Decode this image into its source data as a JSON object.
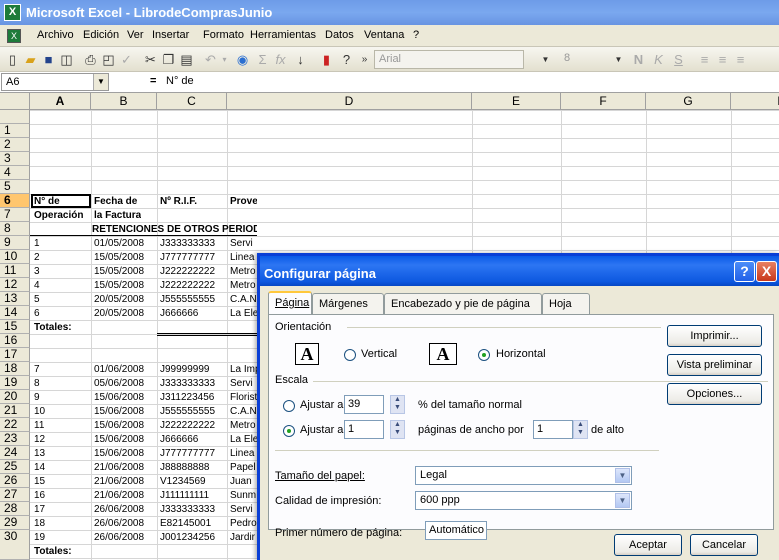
{
  "window": {
    "title": "Microsoft Excel - LibrodeComprasJunio",
    "icon": "excel-icon"
  },
  "menu": [
    "Archivo",
    "Edición",
    "Ver",
    "Insertar",
    "Formato",
    "Herramientas",
    "Datos",
    "Ventana",
    "?"
  ],
  "toolbar": {
    "font": "Arial",
    "size": "8",
    "bold": "N",
    "italic": "K",
    "underline": "S"
  },
  "formula": {
    "namebox": "A6",
    "fx": "=",
    "value": "N° de"
  },
  "columns": [
    "A",
    "B",
    "C",
    "D",
    "E",
    "F",
    "G",
    "H"
  ],
  "rows": [
    "1",
    "2",
    "3",
    "4",
    "5",
    "6",
    "7",
    "8",
    "9",
    "10",
    "11",
    "12",
    "13",
    "14",
    "15",
    "16",
    "17",
    "18",
    "19",
    "20",
    "21",
    "22",
    "23",
    "24",
    "25",
    "26",
    "27",
    "28",
    "29",
    "30"
  ],
  "sheet": {
    "header1": [
      "N° de",
      "Fecha de",
      "Nº R.I.F.",
      "Prove"
    ],
    "header2": [
      "Operación",
      "la Factura"
    ],
    "banner": "RETENCIONES DE OTROS PERIOD",
    "totales": "Totales:",
    "data": [
      [
        "1",
        "01/05/2008",
        "J333333333",
        "Servi"
      ],
      [
        "2",
        "15/05/2008",
        "J777777777",
        "Linea"
      ],
      [
        "3",
        "15/05/2008",
        "J222222222",
        "Metro"
      ],
      [
        "4",
        "15/05/2008",
        "J222222222",
        "Metro"
      ],
      [
        "5",
        "20/05/2008",
        "J555555555",
        "C.A.N"
      ],
      [
        "6",
        "20/05/2008",
        "J666666",
        "La Ele"
      ]
    ],
    "data2": [
      [
        "7",
        "01/06/2008",
        "J99999999",
        "La Imp"
      ],
      [
        "8",
        "05/06/2008",
        "J333333333",
        "Servi"
      ],
      [
        "9",
        "15/06/2008",
        "J311223456",
        "Florist"
      ],
      [
        "10",
        "15/06/2008",
        "J555555555",
        "C.A.N"
      ],
      [
        "11",
        "15/06/2008",
        "J222222222",
        "Metro"
      ],
      [
        "12",
        "15/06/2008",
        "J666666",
        "La Ele"
      ],
      [
        "13",
        "15/06/2008",
        "J777777777",
        "Linea"
      ],
      [
        "14",
        "21/06/2008",
        "J88888888",
        "Papel"
      ],
      [
        "15",
        "21/06/2008",
        "V1234569",
        "Juan"
      ],
      [
        "16",
        "21/06/2008",
        "J111111111",
        "Sunm"
      ],
      [
        "17",
        "26/06/2008",
        "J333333333",
        "Servi"
      ],
      [
        "18",
        "26/06/2008",
        "E82145001",
        "Pedro"
      ],
      [
        "19",
        "26/06/2008",
        "J001234256",
        "Jardir"
      ]
    ],
    "totales2": "Totales:"
  },
  "dialog": {
    "title": "Configurar página",
    "help": "?",
    "close": "X",
    "tabs": [
      "Página",
      "Márgenes",
      "Encabezado y pie de página",
      "Hoja"
    ],
    "orientacion": "Orientación",
    "vertical": "Vertical",
    "horizontal": "Horizontal",
    "escala": "Escala",
    "ajustar_al": "Ajustar al:",
    "ajustar_al_value": "39",
    "pct_text": "% del tamaño normal",
    "ajustar_a": "Ajustar a:",
    "ancho_value": "1",
    "paginas_ancho": "páginas de ancho por",
    "alto_value": "1",
    "de_alto": "de alto",
    "tamano_label": "Tamaño del papel:",
    "tamano_value": "Legal",
    "calidad_label": "Calidad de impresión:",
    "calidad_value": "600 ppp",
    "primer_label": "Primer número de página:",
    "primer_value": "Automático",
    "imprimir": "Imprimir...",
    "vista": "Vista preliminar",
    "opciones": "Opciones...",
    "aceptar": "Aceptar",
    "cancelar": "Cancelar"
  }
}
